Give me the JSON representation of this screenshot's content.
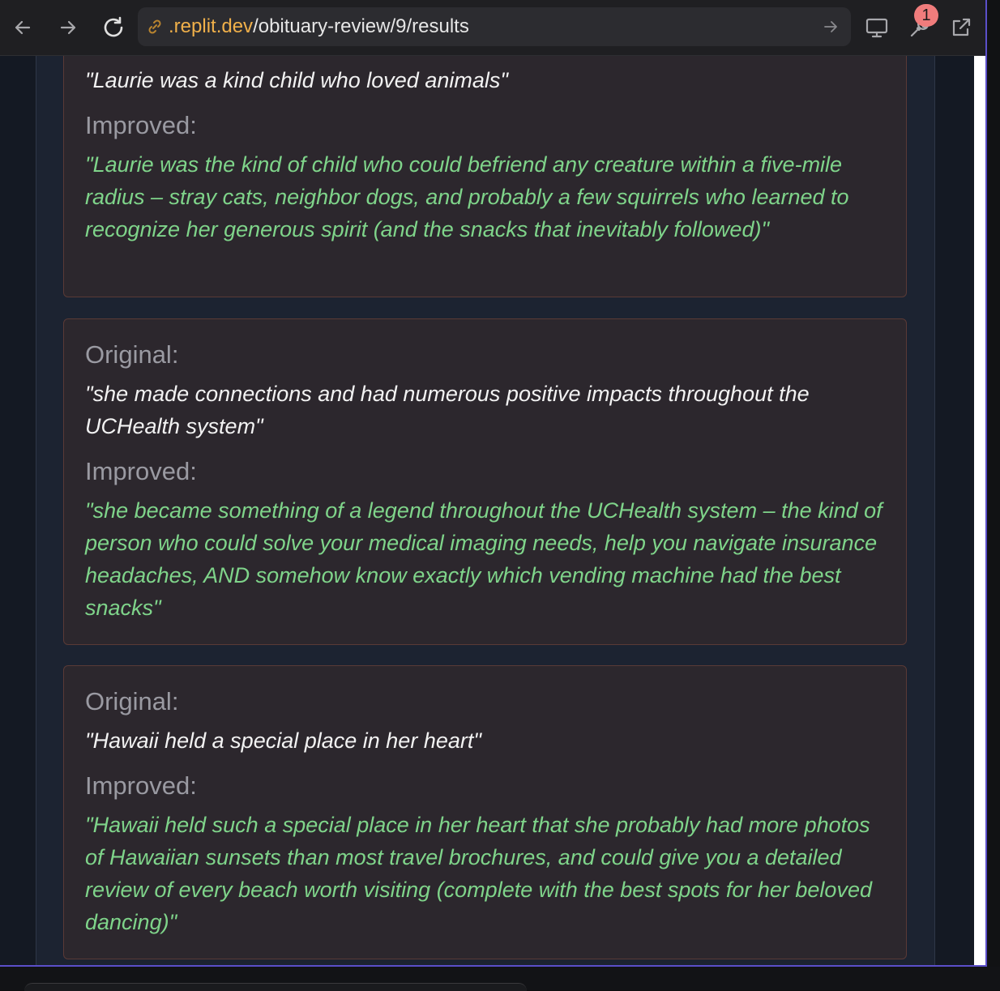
{
  "browser": {
    "url_host": ".replit.dev",
    "url_path": "/obituary-review/9/results",
    "notification_count": "1"
  },
  "labels": {
    "original": "Original:",
    "improved": "Improved:"
  },
  "cards": [
    {
      "original": "\"Laurie was a kind child who loved animals\"",
      "improved": "\"Laurie was the kind of child who could befriend any creature within a five-mile radius – stray cats, neighbor dogs, and probably a few squirrels who learned to recognize her generous spirit (and the snacks that inevitably followed)\""
    },
    {
      "original": "\"she made connections and had numerous positive impacts throughout the UCHealth system\"",
      "improved": "\"she became something of a legend throughout the UCHealth system – the kind of person who could solve your medical imaging needs, help you navigate insurance headaches, AND somehow know exactly which vending machine had the best snacks\""
    },
    {
      "original": "\"Hawaii held a special place in her heart\"",
      "improved": "\"Hawaii held such a special place in her heart that she probably had more photos of Hawaiian sunsets than most travel brochures, and could give you a detailed review of every beach worth visiting (complete with the best spots for her beloved dancing)\""
    }
  ]
}
